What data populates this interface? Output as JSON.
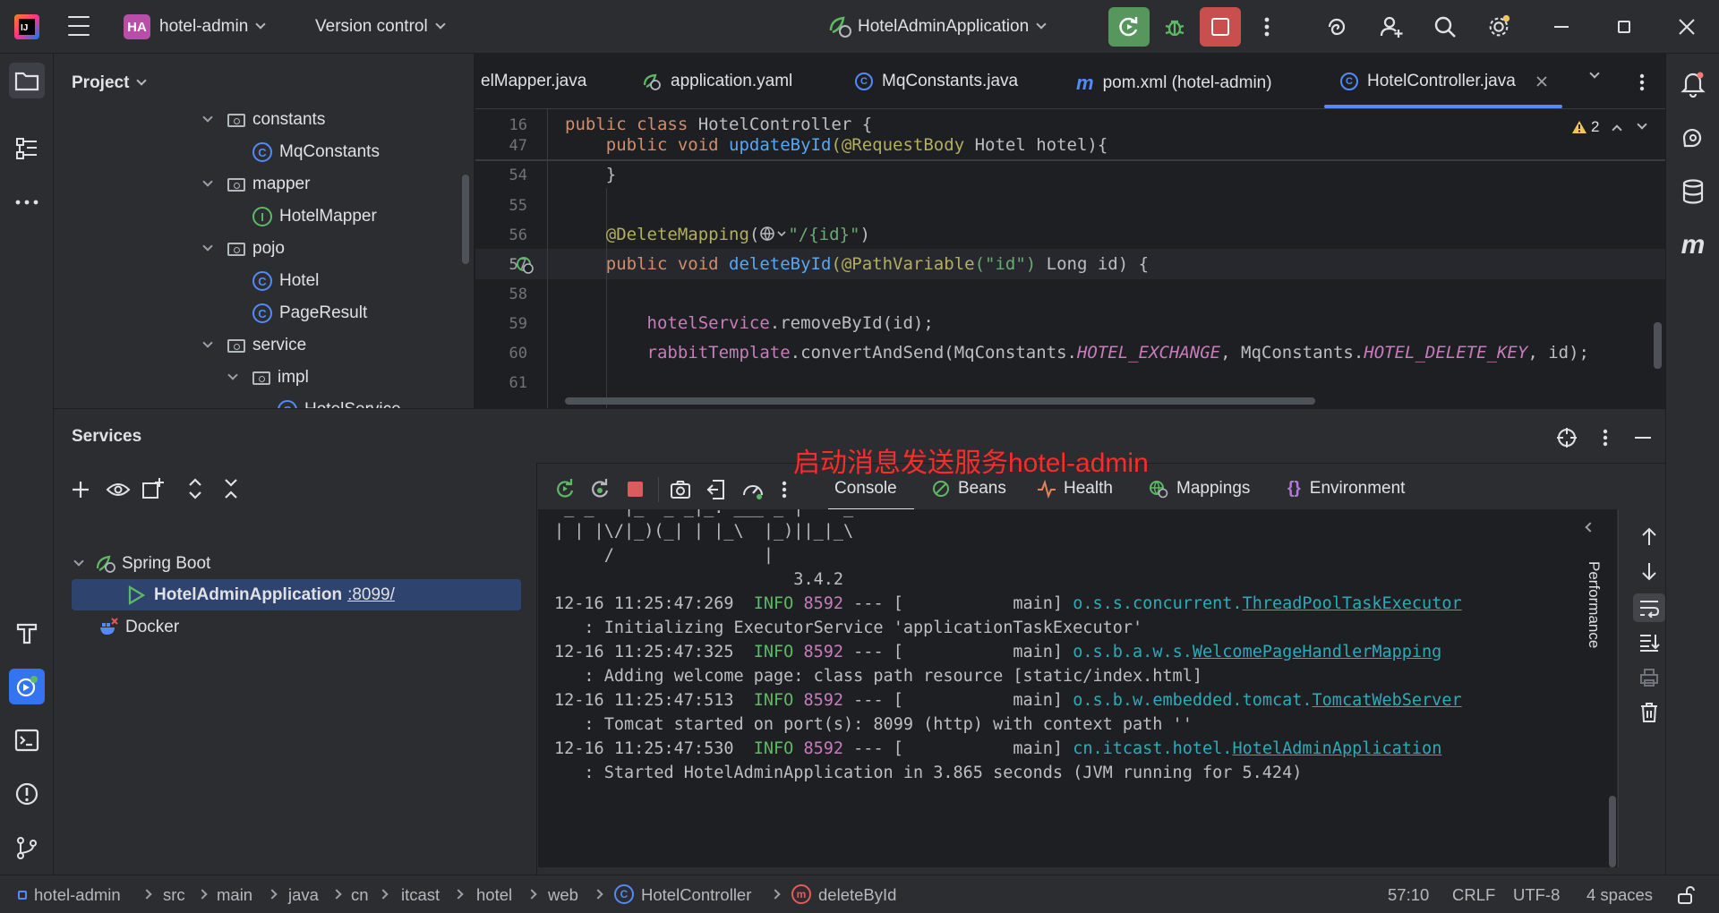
{
  "titlebar": {
    "project_badge": "HA",
    "project_name": "hotel-admin",
    "vcs_label": "Version control",
    "run_config": "HotelAdminApplication"
  },
  "project_panel": {
    "title": "Project",
    "tree": [
      {
        "label": "constants",
        "kind": "folder"
      },
      {
        "label": "MqConstants",
        "kind": "class"
      },
      {
        "label": "mapper",
        "kind": "folder"
      },
      {
        "label": "HotelMapper",
        "kind": "interface"
      },
      {
        "label": "pojo",
        "kind": "folder"
      },
      {
        "label": "Hotel",
        "kind": "class"
      },
      {
        "label": "PageResult",
        "kind": "class"
      },
      {
        "label": "service",
        "kind": "folder"
      },
      {
        "label": "impl",
        "kind": "folder"
      },
      {
        "label": "HotelService",
        "kind": "class"
      }
    ]
  },
  "editor": {
    "tabs": [
      {
        "label": "elMapper.java"
      },
      {
        "label": "application.yaml"
      },
      {
        "label": "MqConstants.java"
      },
      {
        "label": "pom.xml (hotel-admin)"
      },
      {
        "label": "HotelController.java",
        "active": true
      }
    ],
    "warning_count": "2",
    "lines": [
      {
        "num": "16"
      },
      {
        "num": "47"
      },
      {
        "num": "54"
      },
      {
        "num": "55"
      },
      {
        "num": "56"
      },
      {
        "num": "57"
      },
      {
        "num": "58"
      },
      {
        "num": "59"
      },
      {
        "num": "60"
      },
      {
        "num": "61"
      }
    ],
    "code": {
      "l16_kw": "public class",
      "l16_name": " HotelController {",
      "l47_kw": "    public void ",
      "l47_fn": "updateById",
      "l47_ann": "(@RequestBody",
      "l47_rest": " Hotel hotel){",
      "l54": "    }",
      "l56_ann": "    @DeleteMapping",
      "l56_str": "\"/{id}\"",
      "l56_end": ")",
      "l57_kw": "    public void ",
      "l57_fn": "deleteById",
      "l57_ann": "(@PathVariable",
      "l57_str": "(\"id\")",
      "l57_rest": " Long id) {",
      "l59_field": "        hotelService",
      "l59_rest": ".removeById(id);",
      "l60_field": "        rabbitTemplate",
      "l60_a": ".convertAndSend(MqConstants.",
      "l60_c1": "HOTEL_EXCHANGE",
      "l60_b": ", MqConstants.",
      "l60_c2": "HOTEL_DELETE_KEY",
      "l60_end": ", id);"
    }
  },
  "annotation_overlay": "启动消息发送服务hotel-admin",
  "services": {
    "title": "Services",
    "tree": {
      "group": "Spring Boot",
      "app": "HotelAdminApplication",
      "port": ":8099/",
      "docker": "Docker"
    },
    "tabs": [
      {
        "label": "Console"
      },
      {
        "label": "Beans"
      },
      {
        "label": "Health"
      },
      {
        "label": "Mappings"
      },
      {
        "label": "Environment"
      }
    ],
    "side_label": "Performance",
    "console": {
      "banner1": " _ _   |_  _ _|_. ___ _ |    _",
      "banner2": "| | |\\/|_)(_| | |_\\  |_)||_|_\\",
      "banner3": "     /               |",
      "version": "                        3.4.2",
      "logs": [
        {
          "ts": "12-16 11:25:47:269",
          "level": "INFO",
          "pid": "8592",
          "mid": " --- [           main] ",
          "pkg": "o.s.s.concurrent.",
          "cls": "ThreadPoolTaskExecutor",
          "msg": "   : Initializing ExecutorService 'applicationTaskExecutor'"
        },
        {
          "ts": "12-16 11:25:47:325",
          "level": "INFO",
          "pid": "8592",
          "mid": " --- [           main] ",
          "pkg": "o.s.b.a.w.s.",
          "cls": "WelcomePageHandlerMapping",
          "msg": "   : Adding welcome page: class path resource [static/index.html]"
        },
        {
          "ts": "12-16 11:25:47:513",
          "level": "INFO",
          "pid": "8592",
          "mid": " --- [           main] ",
          "pkg": "o.s.b.w.embedded.tomcat.",
          "cls": "TomcatWebServer",
          "msg": "   : Tomcat started on port(s): 8099 (http) with context path ''"
        },
        {
          "ts": "12-16 11:25:47:530",
          "level": "INFO",
          "pid": "8592",
          "mid": " --- [           main] ",
          "pkg": "cn.itcast.hotel.",
          "cls": "HotelAdminApplication",
          "msg": "   : Started HotelAdminApplication in 3.865 seconds (JVM running for 5.424)"
        }
      ]
    }
  },
  "statusbar": {
    "breadcrumbs": [
      "hotel-admin",
      "src",
      "main",
      "java",
      "cn",
      "itcast",
      "hotel",
      "web",
      "HotelController",
      "deleteById"
    ],
    "position": "57:10",
    "line_sep": "CRLF",
    "encoding": "UTF-8",
    "indent": "4 spaces"
  },
  "colors": {
    "accent": "#548af7",
    "run_green": "#57965c",
    "stop_red": "#c94f4f",
    "overlay_red": "#ff2a2a"
  }
}
